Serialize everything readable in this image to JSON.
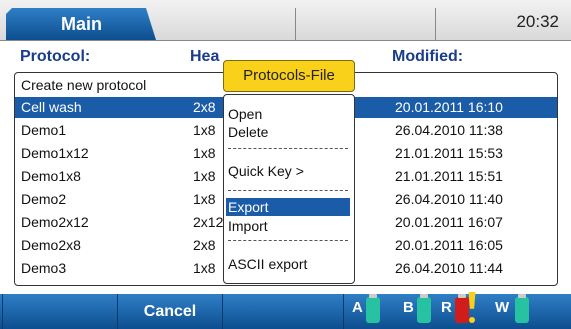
{
  "tabs": {
    "main_label": "Main"
  },
  "clock": "20:32",
  "headers": {
    "protocol": "Protocol:",
    "heads": "Hea",
    "modified": "Modified:"
  },
  "rows": [
    {
      "name": "Create new protocol",
      "heads": "",
      "modified": ""
    },
    {
      "name": "Cell wash",
      "heads": "2x8",
      "modified": "20.01.2011 16:10",
      "selected": true
    },
    {
      "name": "Demo1",
      "heads": "1x8",
      "modified": "26.04.2010 11:38"
    },
    {
      "name": "Demo1x12",
      "heads": "1x8",
      "modified": "21.01.2011 15:53"
    },
    {
      "name": "Demo1x8",
      "heads": "1x8",
      "modified": "21.01.2011 15:51"
    },
    {
      "name": "Demo2",
      "heads": "1x8",
      "modified": "26.04.2010 11:40"
    },
    {
      "name": "Demo2x12",
      "heads": "2x12",
      "modified": "20.01.2011 16:07"
    },
    {
      "name": "Demo2x8",
      "heads": "2x8",
      "modified": "20.01.2011 16:05"
    },
    {
      "name": "Demo3",
      "heads": "1x8",
      "modified": "26.04.2010 11:44"
    }
  ],
  "popup": {
    "title": "Protocols-File",
    "items": [
      "Open",
      "Delete",
      "Quick Key >",
      "Export",
      "Import",
      "ASCII export"
    ],
    "active_item": "Export",
    "separator": "----------------------------"
  },
  "bottom": {
    "cancel_label": "Cancel",
    "bottles": [
      {
        "label": "A",
        "color": "#27c2a2"
      },
      {
        "label": "B",
        "color": "#27c2a2"
      },
      {
        "label": "R",
        "color": "#d11c1c"
      },
      {
        "label": "W",
        "color": "#27c2a2"
      }
    ],
    "warning_color": "#f9d11b"
  },
  "colors": {
    "accent": "#1b5ca8",
    "header_text": "#1b3c8a",
    "popup_title_bg": "#f9d11b"
  }
}
